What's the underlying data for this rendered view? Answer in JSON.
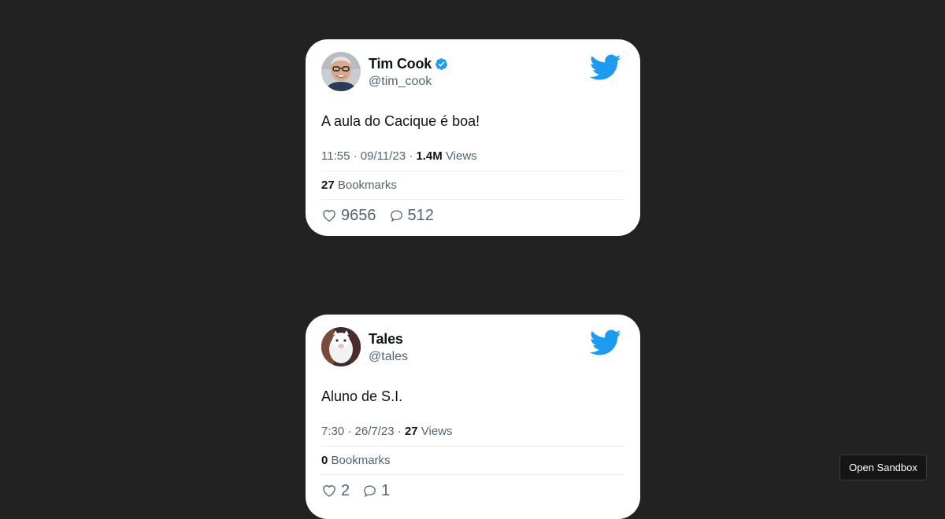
{
  "tweets": [
    {
      "name": "Tim Cook",
      "verified": true,
      "handle": "@tim_cook",
      "text": "A aula do Cacique é boa!",
      "time": "11:55",
      "date": "09/11/23",
      "views": "1.4M",
      "views_label": "Views",
      "bookmarks": "27",
      "bookmarks_label": "Bookmarks",
      "likes": "9656",
      "replies": "512"
    },
    {
      "name": "Tales",
      "verified": false,
      "handle": "@tales",
      "text": "Aluno de S.I.",
      "time": "7:30",
      "date": "26/7/23",
      "views": "27",
      "views_label": "Views",
      "bookmarks": "0",
      "bookmarks_label": "Bookmarks",
      "likes": "2",
      "replies": "1"
    }
  ],
  "meta_separator": "·",
  "sandbox_button": "Open Sandbox",
  "colors": {
    "background": "#222222",
    "card": "#ffffff",
    "twitter_blue": "#1d9bf0",
    "muted_text": "#536471"
  },
  "icons": [
    "twitter-bird-icon",
    "verified-badge-icon",
    "heart-icon",
    "comment-icon"
  ]
}
